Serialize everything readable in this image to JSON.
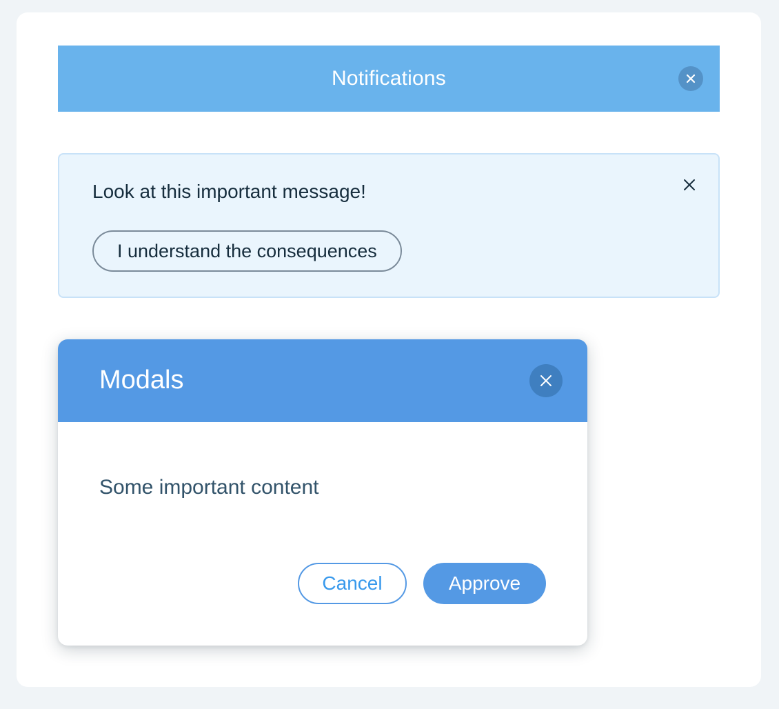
{
  "notifications": {
    "title": "Notifications",
    "close_icon": "close-icon",
    "bar_color": "#69b3ec"
  },
  "message": {
    "text": "Look at this important message!",
    "action_label": "I understand the consequences",
    "close_icon": "close-icon",
    "background_color": "#eaf5fd"
  },
  "modal": {
    "title": "Modals",
    "content": "Some important content",
    "cancel_label": "Cancel",
    "approve_label": "Approve",
    "close_icon": "close-icon",
    "header_color": "#5499e4"
  }
}
